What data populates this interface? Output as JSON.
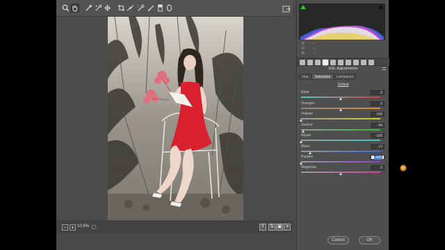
{
  "toolbar": {
    "tools": [
      "zoom-tool",
      "hand-tool",
      "white-balance-tool",
      "color-sampler-tool",
      "targeted-adjustment-tool",
      "crop-tool",
      "straighten-tool",
      "spot-removal-tool",
      "adjustment-brush-tool",
      "graduated-filter-tool",
      "radial-filter-tool"
    ],
    "active_tool": "hand-tool"
  },
  "preview": {
    "zoom": "10.5%"
  },
  "histogram": {
    "r_label": "R:",
    "g_label": "G:",
    "b_label": "B:",
    "r_value": "---",
    "g_value": "---",
    "b_value": "---"
  },
  "panel": {
    "title": "HSL Adjustments",
    "tabs": [
      "Hue",
      "Saturation",
      "Luminance"
    ],
    "active_tab": "Saturation",
    "default_link": "Default",
    "sliders": [
      {
        "label": "Reds",
        "value": "0",
        "level": 0,
        "colors": [
          "#5ac6c6",
          "#d04040"
        ]
      },
      {
        "label": "Oranges",
        "value": "0",
        "level": 0,
        "colors": [
          "#8a8a8a",
          "#e08a30"
        ]
      },
      {
        "label": "Yellows",
        "value": "-100",
        "level": -100,
        "colors": [
          "#9a9a9a",
          "#d8c830"
        ]
      },
      {
        "label": "Greens",
        "value": "-94",
        "level": -94,
        "colors": [
          "#9a9a9a",
          "#40b040"
        ]
      },
      {
        "label": "Aquas",
        "value": "-100",
        "level": -100,
        "colors": [
          "#9a9a9a",
          "#40c0c0"
        ]
      },
      {
        "label": "Blues",
        "value": "-77",
        "level": -77,
        "colors": [
          "#9a9a9a",
          "#3a6ad8"
        ]
      },
      {
        "label": "Purples",
        "value": "-100",
        "level": -100,
        "colors": [
          "#9a9a9a",
          "#9040c8"
        ]
      },
      {
        "label": "Magentas",
        "value": "0",
        "level": 0,
        "colors": [
          "#9a9a9a",
          "#d040a0"
        ]
      }
    ]
  },
  "buttons": {
    "cancel": "Cancel",
    "ok": "OK"
  }
}
